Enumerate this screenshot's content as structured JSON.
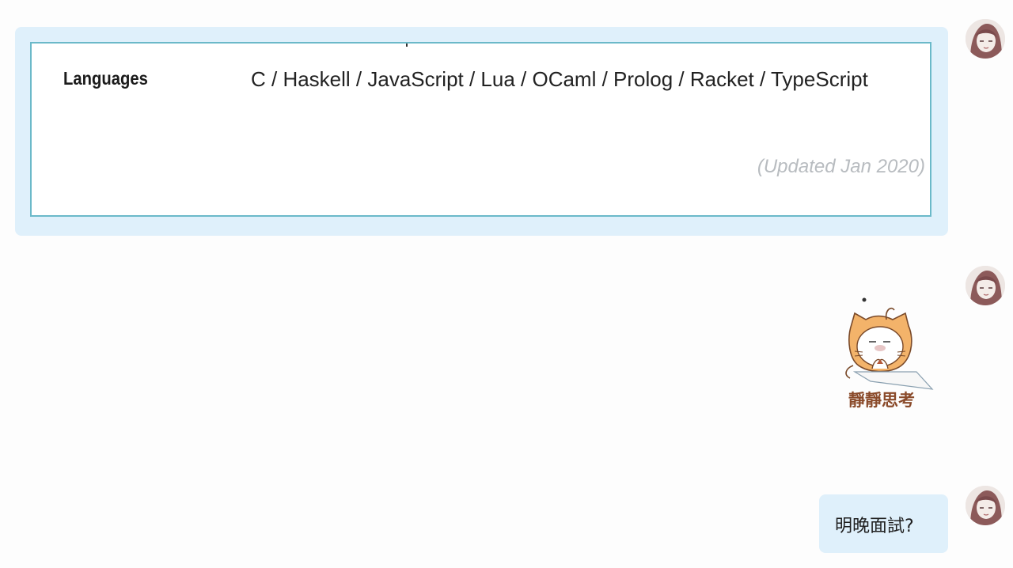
{
  "messages": [
    {
      "type": "card",
      "card": {
        "row_label": "Languages",
        "row_value": "C / Haskell / JavaScript / Lua / OCaml / Prolog / Racket / TypeScript",
        "updated_note": "(Updated Jan 2020)"
      }
    },
    {
      "type": "sticker",
      "sticker": {
        "caption": "靜靜思考",
        "icon": "thinking-cat-sticker"
      }
    },
    {
      "type": "text",
      "text": "明晚面試?"
    }
  ],
  "colors": {
    "bubble": "#dff0fb",
    "card_border": "#6bb9c9",
    "background": "#fdfdfd",
    "muted_text": "#b8bcc0",
    "sticker_orange": "#f3b36a",
    "sticker_caption": "#8a4a2a"
  }
}
